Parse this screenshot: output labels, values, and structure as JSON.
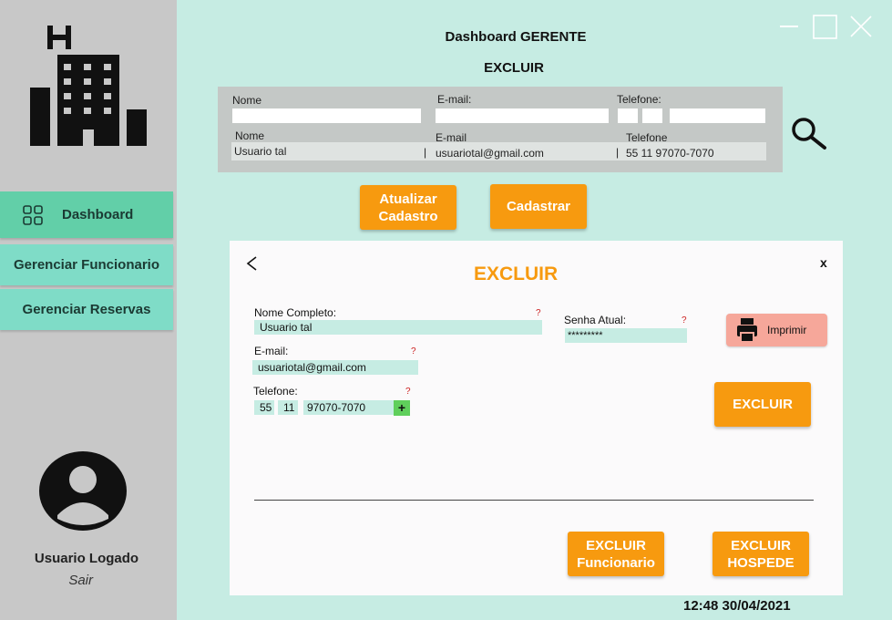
{
  "sidebar": {
    "items": [
      {
        "label": "Dashboard"
      },
      {
        "label": "Gerenciar Funcionario"
      },
      {
        "label": "Gerenciar Reservas"
      }
    ],
    "user_name": "Usuario Logado",
    "logout": "Sair"
  },
  "header": {
    "title": "Dashboard GERENTE",
    "subtitle": "EXCLUIR"
  },
  "search": {
    "labels": {
      "name": "Nome",
      "email": "E-mail:",
      "phone": "Telefone:"
    },
    "result_headers": {
      "name": "Nome",
      "email": "E-mail",
      "phone": "Telefone"
    },
    "result": {
      "name": "Usuario tal",
      "email": "usuariotal@gmail.com",
      "phone": "55 11 97070-7070",
      "sep": "|"
    }
  },
  "actions": {
    "update": "Atualizar Cadastro",
    "register": "Cadastrar"
  },
  "form": {
    "title": "EXCLUIR",
    "close": "x",
    "full_name_label": "Nome Completo:",
    "full_name_value": "Usuario tal",
    "email_label": "E-mail:",
    "email_value": "usuariotal@gmail.com",
    "phone_label": "Telefone:",
    "phone_country": "55",
    "phone_area": "11",
    "phone_number": "97070-7070",
    "plus": "+",
    "password_label": "Senha Atual:",
    "password_value": "*********",
    "help_mark": "?",
    "print_label": "Imprimir",
    "delete_label": "EXCLUIR",
    "delete_employee": "EXCLUIR Funcionario",
    "delete_guest": "EXCLUIR HOSPEDE"
  },
  "status": {
    "time": "12:48",
    "date": "30/04/2021"
  },
  "colors": {
    "accent": "#f79a0f",
    "background": "#c6ece3",
    "sidebar": "#c8c8c8",
    "nav": "#7fdcc7",
    "print": "#f6a79a"
  }
}
